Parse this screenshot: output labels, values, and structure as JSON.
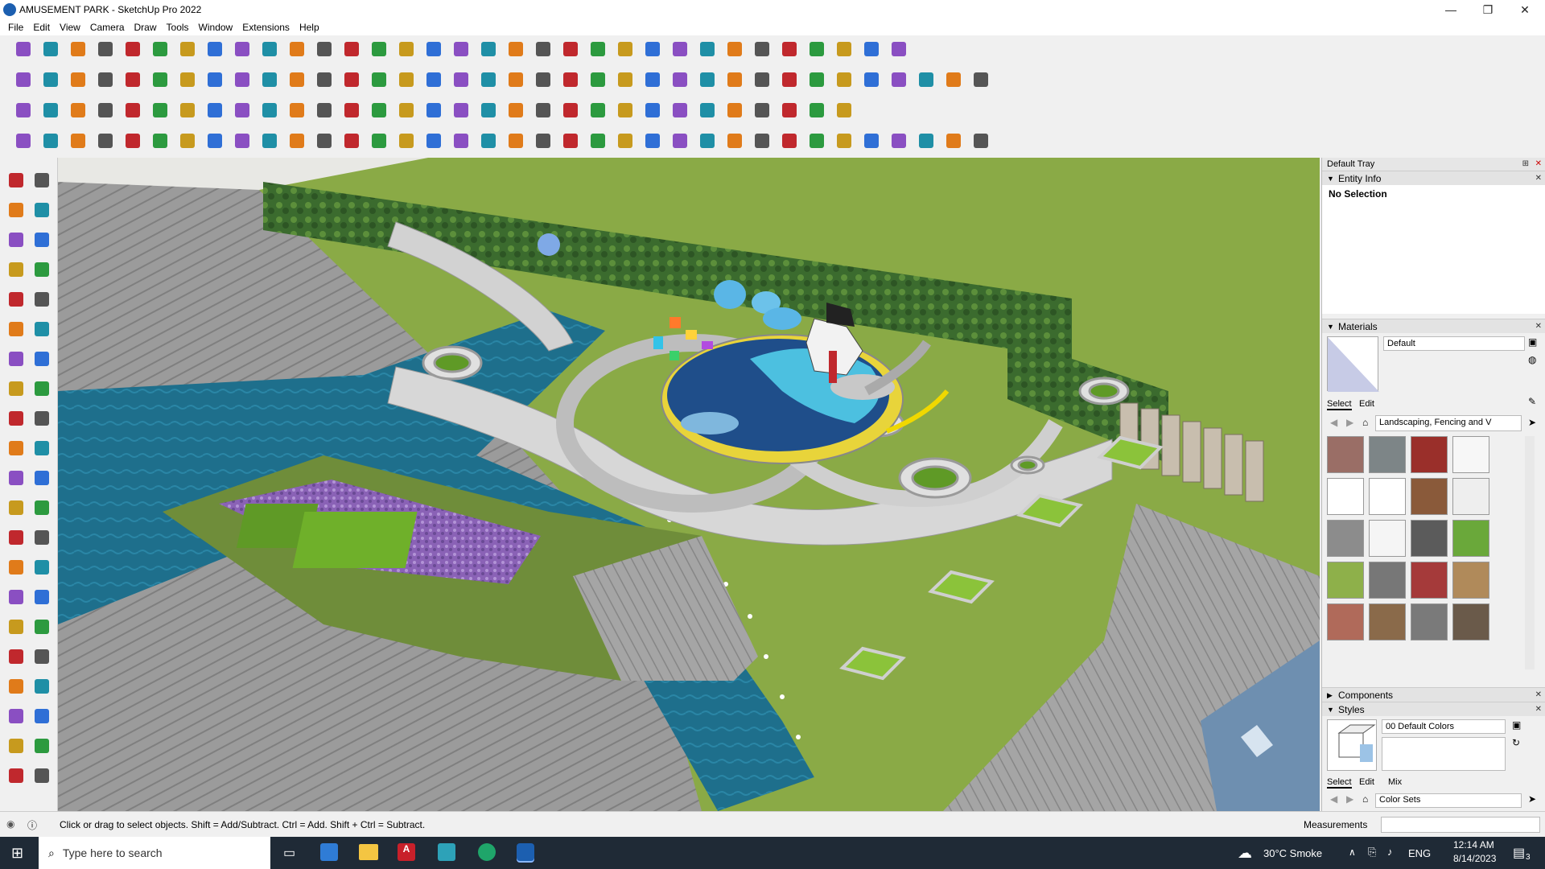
{
  "window": {
    "title": "AMUSEMENT PARK - SketchUp Pro 2022",
    "controls": [
      "—",
      "❐",
      "✕"
    ]
  },
  "menu": [
    "File",
    "Edit",
    "View",
    "Camera",
    "Draw",
    "Tools",
    "Window",
    "Extensions",
    "Help"
  ],
  "tray": {
    "title": "Default Tray",
    "entity_info": {
      "header": "Entity Info",
      "selection": "No Selection"
    },
    "materials": {
      "header": "Materials",
      "current": "Default",
      "tabs": [
        "Select",
        "Edit"
      ],
      "collection": "Landscaping, Fencing and V"
    },
    "components": {
      "header": "Components"
    },
    "styles": {
      "header": "Styles",
      "current": "00 Default Colors",
      "tabs": [
        "Select",
        "Edit",
        "Mix"
      ],
      "collection": "Color Sets"
    }
  },
  "status": {
    "hint": "Click or drag to select objects. Shift = Add/Subtract. Ctrl = Add. Shift + Ctrl = Subtract.",
    "measurements_label": "Measurements"
  },
  "taskbar": {
    "search_placeholder": "Type here to search",
    "weather": "30°C  Smoke",
    "language": "ENG",
    "time": "12:14 AM",
    "date": "8/14/2023",
    "notification_count": "3"
  },
  "colors": {
    "accent_blue": "#1c5fb0",
    "grass": "#8aaa46",
    "water": "#1e6f8c",
    "paving": "#9a9a9a",
    "sky": "#f3f3ee"
  },
  "icons": {
    "toolbar_row1": [
      "zoom-icon",
      "select-icon",
      "eraser-icon",
      "pencil-icon",
      "freehand-icon",
      "rectangle-icon",
      "push-pull-icon",
      "follow-me-icon",
      "move-icon",
      "rotate-icon",
      "scale-icon",
      "tape-measure-icon",
      "text-icon",
      "paint-bucket-icon",
      "orbit-icon",
      "pan-icon",
      "zoom-window-icon",
      "zoom-extents-icon",
      "section-plane-icon",
      "outer-shell-icon",
      "intersect-icon",
      "union-icon",
      "user-icon",
      "warehouse-icon",
      "share-model-icon",
      "extension-icon",
      "up-arrow-icon",
      "down-arrow-icon",
      "axes-icon",
      "solid-icon",
      "undo-icon",
      "redo-icon",
      "hand-icon"
    ],
    "toolbar_row2": [
      "iso-view-icon",
      "top-view-icon",
      "front-view-icon",
      "follow-icon",
      "sandbox-icon",
      "stamp-icon",
      "drape-icon",
      "add-detail-icon",
      "flip-edge-icon",
      "smoove-icon",
      "house-icon",
      "roof-icon",
      "wall-icon",
      "window-icon",
      "door-icon",
      "curtain-icon",
      "fence-icon",
      "cut-icon",
      "arc-icon",
      "circle-icon",
      "polygon-icon",
      "ellipse-icon",
      "parallelogram-icon",
      "lasso-icon",
      "rope-icon",
      "explode-icon",
      "scissors-icon",
      "divide-icon",
      "erase-icon",
      "trim-icon",
      "book-icon",
      "grid-icon",
      "box-icon",
      "shelf-icon",
      "brick-icon",
      "stone-icon"
    ],
    "toolbar_row3": [
      "cube-blue-icon",
      "plane-icon",
      "tile-icon",
      "camera-icon",
      "arc-orange-icon",
      "square-red-icon",
      "grid-plain-icon",
      "fold-icon",
      "box-wood-icon",
      "chain-icon",
      "nodes-icon",
      "plus-red-icon",
      "plus-green-icon",
      "star-blue-icon",
      "triangle-icon",
      "tent-icon",
      "curve-icon",
      "spiral-icon",
      "loop-icon",
      "network-icon",
      "bag-icon",
      "magnet-icon",
      "cube-green-icon",
      "shape-icon",
      "layers-icon",
      "pattern-icon",
      "panel-icon",
      "wall-block-icon",
      "cross-icon",
      "dotted-arc-icon",
      "tile-grid-icon"
    ],
    "toolbar_row4": [
      "spline-icon",
      "spline-red-icon",
      "vehicle-icon",
      "loop-blue-icon",
      "sweep-icon",
      "lines-icon",
      "helix-icon",
      "hook-icon",
      "angle-icon",
      "red-line-icon",
      "curve-edge-icon",
      "arch-icon",
      "beam-icon",
      "ribs-icon",
      "column-icon",
      "hand-grab-icon",
      "leaf-icon",
      "wing-icon",
      "shell-icon",
      "comb-icon",
      "frame-icon",
      "lattice-icon",
      "dome-icon",
      "zigzag-icon",
      "mesh-icon",
      "cushion-icon",
      "stairs-icon",
      "wave-icon",
      "mesh-dense-icon",
      "grid-lines-icon",
      "bars-icon",
      "fan-icon",
      "fan-dark-icon",
      "slope-icon",
      "spider-icon",
      "cube-outline-icon"
    ],
    "left_tools": [
      "select-tool-icon",
      "orbit-tool-icon",
      "paint-tool-icon",
      "eraser-tool-icon",
      "component-tool-icon",
      "tape-tool-icon",
      "line-tool-icon",
      "freehand-tool-icon",
      "rectangle-tool-icon",
      "rotated-rect-icon",
      "circle-tool-icon",
      "polygon-tool-icon",
      "arc-tool-icon",
      "pie-tool-icon",
      "arc3-tool-icon",
      "arc2-tool-icon",
      "move-tool-icon",
      "pushpull-tool-icon",
      "rotate-tool-icon",
      "followme-tool-icon",
      "scale-tool-icon",
      "offset-tool-icon",
      "measure-tool-icon",
      "dimension-tool-icon",
      "protractor-tool-icon",
      "text-tool-icon",
      "axes-tool-icon",
      "3dtext-tool-icon",
      "orbit2-tool-icon",
      "pan-tool-icon",
      "zoom-tool-icon",
      "zoom-window-tool-icon",
      "zoom-extents-tool-icon",
      "previous-icon",
      "position-camera-icon",
      "look-around-icon",
      "walk-icon",
      "section-tool-icon",
      "shell-tool-icon",
      "intersect-tool-icon",
      "layer-tool-icon",
      "texture-tool-icon"
    ]
  }
}
